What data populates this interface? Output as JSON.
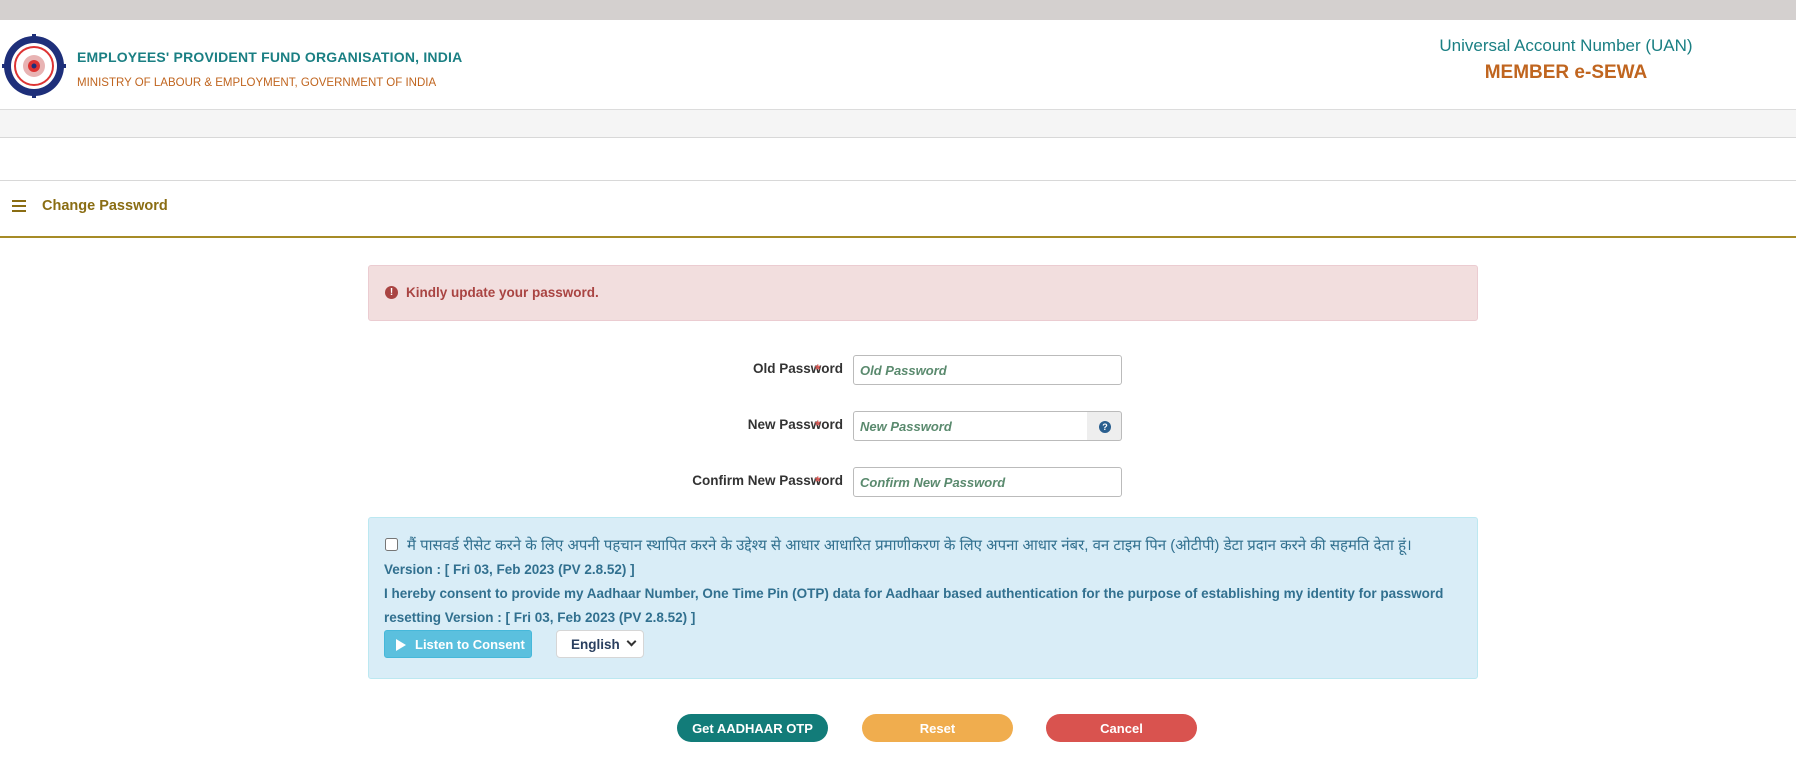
{
  "header": {
    "org_name": "EMPLOYEES' PROVIDENT FUND ORGANISATION, INDIA",
    "ministry": "MINISTRY OF LABOUR & EMPLOYMENT, GOVERNMENT OF INDIA",
    "uan_title": "Universal Account Number (UAN)",
    "uan_subtitle": "MEMBER e-SEWA"
  },
  "page": {
    "title": "Change Password"
  },
  "alert": {
    "message": "Kindly update your password."
  },
  "form": {
    "old_password": {
      "label": "Old Password",
      "required_mark": "*",
      "placeholder": "Old Password"
    },
    "new_password": {
      "label": "New Password",
      "required_mark": "*",
      "placeholder": "New Password"
    },
    "confirm_password": {
      "label": "Confirm New Password",
      "required_mark": "*",
      "placeholder": "Confirm New Password"
    }
  },
  "consent": {
    "hindi_text": "मैं पासवर्ड रीसेट करने के लिए अपनी पहचान स्थापित करने के उद्देश्य से आधार आधारित प्रमाणीकरण के लिए अपना आधार नंबर, वन टाइम पिन (ओटीपी) डेटा प्रदान करने की सहमति देता हूं।",
    "hindi_version": "Version : [ Fri 03, Feb 2023 (PV 2.8.52) ]",
    "english_text": "I hereby consent to provide my Aadhaar Number, One Time Pin (OTP) data for Aadhaar based authentication for the purpose of establishing my identity for password resetting Version : [ Fri 03, Feb 2023 (PV 2.8.52) ]",
    "listen_label": "Listen to Consent",
    "language": "English"
  },
  "actions": {
    "otp_label": "Get AADHAAR OTP",
    "reset_label": "Reset",
    "cancel_label": "Cancel"
  },
  "colors": {
    "teal": "#127c79",
    "orange": "#c0651f",
    "gold": "#8a6d13",
    "danger": "#d9534f",
    "warning": "#f0ad4e",
    "info": "#5bc0de"
  }
}
